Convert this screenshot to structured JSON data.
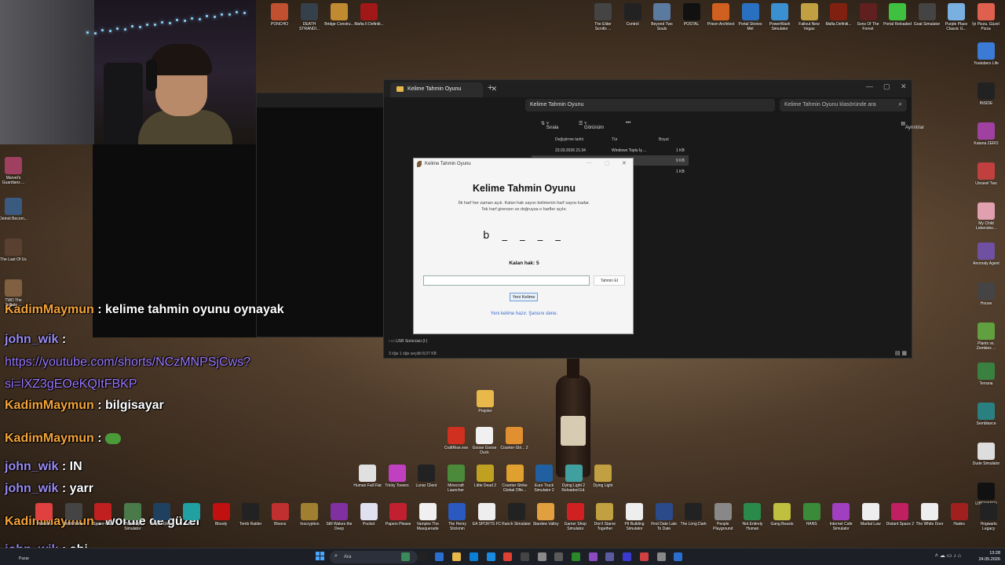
{
  "explorer": {
    "tab_title": "Kelime Tahmin Oyunu",
    "close_tab": "✕",
    "new_tab": "+",
    "address": "Kelime Tahmin Oyunu",
    "search_placeholder": "Kelime Tahmin Oyunu klasöründe ara",
    "sort": "Sırala",
    "view": "Görünüm",
    "more": "•••",
    "details": "Ayrıntılar",
    "col_date": "Değiştirme tarihi",
    "col_type": "Tür",
    "col_size": "Boyut",
    "rows": [
      {
        "date": "23.03.2026 21:34",
        "type": "Windows Toplu İş ...",
        "size": "1 KB"
      },
      {
        "date": "",
        "type": "",
        "size": "9 KB"
      },
      {
        "date": "",
        "type": "",
        "size": "1 KB"
      }
    ],
    "nav_usb": "USB Sürücüsü (I:)",
    "status": "3 öğe    1 öğe seçildi  8,07 KB"
  },
  "game": {
    "window_title": "Kelime Tahmin Oyunu",
    "heading": "Kelime Tahmin Oyunu",
    "desc_line1": "İlk harf her zaman açık. Kalan hak sayısı kelimenin harf sayısı kadar.",
    "desc_line2": "Tek harf girersen ve doğruysa o harfler açılır.",
    "word": "b _ _ _ _",
    "lives": "Kalan hak: 5",
    "input_value": "",
    "guess_button": "Tahmin Et",
    "new_word_button": "Yeni Kelime",
    "status": "Yeni kelime hazır. Şansını dene."
  },
  "chat": [
    {
      "user": "KadimMaymun",
      "text": ": kelime tahmin oyunu oynayak",
      "color": "#f5a43a"
    },
    {
      "user": "john_wik",
      "text": ":",
      "color": "#9a8cf0"
    },
    {
      "user": "",
      "text": "https://youtube.com/shorts/NCzMNPSjCws?",
      "color": "#9b78ff"
    },
    {
      "user": "",
      "text": "si=lXZ3gEOeKQItFBKP",
      "color": "#9b78ff"
    },
    {
      "user": "KadimMaymun",
      "text": ": bilgisayar",
      "color": "#f5a43a"
    },
    {
      "user": "KadimMaymun",
      "text": ":",
      "color": "#f5a43a"
    },
    {
      "user": "john_wik",
      "text": ": IN",
      "color": "#9a8cf0"
    },
    {
      "user": "john_wik",
      "text": ": yarr",
      "color": "#9a8cf0"
    },
    {
      "user": "KadimMaymun",
      "text": ": wordle de güzel",
      "color": "#f5a43a"
    },
    {
      "user": "john_wik",
      "text": ": abi",
      "color": "#9a8cf0"
    }
  ],
  "desktop_top": [
    {
      "label": "PONCHO",
      "color": "#c05030"
    },
    {
      "label": "DEATH STRANDI...",
      "color": "#34404a"
    },
    {
      "label": "Bridge Constru...",
      "color": "#c08a30"
    },
    {
      "label": "Mafia II Definiti...",
      "color": "#a01818"
    }
  ],
  "desktop_right_top": [
    {
      "label": "The Elder Scrolls ...",
      "color": "#444"
    },
    {
      "label": "Control",
      "color": "#222"
    },
    {
      "label": "Beyond Two Souls",
      "color": "#5a7aa0"
    },
    {
      "label": "POSTAL",
      "color": "#111"
    },
    {
      "label": "Prison Architect",
      "color": "#d06020"
    },
    {
      "label": "Portal Stories Mel",
      "color": "#2a70c0"
    },
    {
      "label": "PowerWash Simulator",
      "color": "#3a90d0"
    },
    {
      "label": "Fallout New Vegas",
      "color": "#c0a040"
    },
    {
      "label": "Mafia Definiti...",
      "color": "#802010"
    },
    {
      "label": "Sons Of The Forest",
      "color": "#602020"
    },
    {
      "label": "Portal Reloaded",
      "color": "#40c040"
    },
    {
      "label": "Goat Simulator",
      "color": "#444"
    },
    {
      "label": "Purple Place Classic G...",
      "color": "#7ab0e0"
    },
    {
      "label": "İyi Pizza, Güzel Pizza",
      "color": "#e06050"
    }
  ],
  "desktop_right_col": [
    {
      "label": "Youtubers Life",
      "color": "#3b7bd6"
    },
    {
      "label": "INSIDE",
      "color": "#222"
    },
    {
      "label": "Katana ZERO",
      "color": "#a040a0"
    },
    {
      "label": "Unravel Two",
      "color": "#c04040"
    },
    {
      "label": "My Child Lebensbo...",
      "color": "#e0a0b0"
    },
    {
      "label": "Anomaly Agent",
      "color": "#7050a0"
    },
    {
      "label": "House",
      "color": "#444"
    },
    {
      "label": "Plants vs. Zombies ...",
      "color": "#60a040"
    },
    {
      "label": "Terraria",
      "color": "#3a8040"
    },
    {
      "label": "Semblance",
      "color": "#2a8080"
    },
    {
      "label": "Dude Simulator",
      "color": "#ddd"
    },
    {
      "label": "LIBERATED",
      "color": "#111"
    }
  ],
  "desktop_left_col": [
    {
      "label": "Marvel's Guardians ...",
      "color": "#a04060"
    },
    {
      "label": "Detroit Becom...",
      "color": "#3a5a80"
    },
    {
      "label": "The Last Of Us",
      "color": "#5a4030"
    },
    {
      "label": "TWD The Telltale ...",
      "color": "#806040"
    }
  ],
  "desktop_mid": [
    {
      "label": "Projeler",
      "color": "#e8b84a"
    },
    {
      "label": "CraftRise.exe",
      "color": "#d03020"
    },
    {
      "label": "Goose Goose Duck",
      "color": "#f0f0f0"
    },
    {
      "label": "Counter-Stri... 2",
      "color": "#e09030"
    }
  ],
  "desktop_row2": [
    {
      "label": "Human Fall Flat",
      "color": "#e0e0e0"
    },
    {
      "label": "Tricky Towers",
      "color": "#c040c0"
    },
    {
      "label": "Lunar Client",
      "color": "#222"
    },
    {
      "label": "Minecraft Launcher",
      "color": "#4a8a3a"
    },
    {
      "label": "Little Dead 2",
      "color": "#c0a020"
    },
    {
      "label": "Counter-Strike Global Offe...",
      "color": "#e0a030"
    },
    {
      "label": "Euro Truck Simulator 2",
      "color": "#2060a0"
    },
    {
      "label": "Dying Light 2 Reloaded Ed.",
      "color": "#40a0a0"
    },
    {
      "label": "Dying Light",
      "color": "#c0a040"
    }
  ],
  "desktop_bottom": [
    {
      "label": "Horizon",
      "color": "#e04040"
    },
    {
      "label": "WAR Mine",
      "color": "#444"
    },
    {
      "label": "Spider-Man",
      "color": "#c02020"
    },
    {
      "label": "Tabletop Simulator",
      "color": "#4a7a4a"
    },
    {
      "label": "Sniper Ghost",
      "color": "#204060"
    },
    {
      "label": "Bee",
      "color": "#20a0a0"
    },
    {
      "label": "Bloody",
      "color": "#c01010"
    },
    {
      "label": "Tomb Raider",
      "color": "#222"
    },
    {
      "label": "Bloons",
      "color": "#c03030"
    },
    {
      "label": "Inscryption",
      "color": "#a08030"
    },
    {
      "label": "Still Wakes the Deep",
      "color": "#8030a0"
    },
    {
      "label": "Pocket",
      "color": "#e0e0f0"
    },
    {
      "label": "Papers Please",
      "color": "#c02030"
    },
    {
      "label": "Vampire The Masquerade",
      "color": "#f0f0f0"
    },
    {
      "label": "The Henry Stickmin",
      "color": "#2a5ac0"
    },
    {
      "label": "EA SPORTS FC",
      "color": "#eee"
    },
    {
      "label": "Ranch Simulator",
      "color": "#222"
    },
    {
      "label": "Stardew Valley",
      "color": "#e0a040"
    },
    {
      "label": "Gamer Shop Simulator",
      "color": "#d02020"
    },
    {
      "label": "Don't Starve Together",
      "color": "#c0a040"
    },
    {
      "label": "Pit Building Simulator",
      "color": "#eee"
    },
    {
      "label": "First Date Late To Date",
      "color": "#2a4a8a"
    },
    {
      "label": "The Long Dark",
      "color": "#222"
    },
    {
      "label": "People Playground",
      "color": "#888"
    },
    {
      "label": "Not Entirely Human",
      "color": "#2a8a4a"
    },
    {
      "label": "Gang Beasts",
      "color": "#c0c040"
    },
    {
      "label": "HANS",
      "color": "#3a8a3a"
    },
    {
      "label": "Internet Cafe Simulator",
      "color": "#a040c0"
    },
    {
      "label": "Martial Law",
      "color": "#eee"
    },
    {
      "label": "Distant Space 2",
      "color": "#c02060"
    },
    {
      "label": "The White Door",
      "color": "#eee"
    },
    {
      "label": "Hades",
      "color": "#a02020"
    },
    {
      "label": "Hogwarts Legacy",
      "color": "#222"
    }
  ],
  "taskbar": {
    "left_label": "Pazar",
    "search": "Ara",
    "time": "13:28",
    "date": "24.05.2026"
  }
}
